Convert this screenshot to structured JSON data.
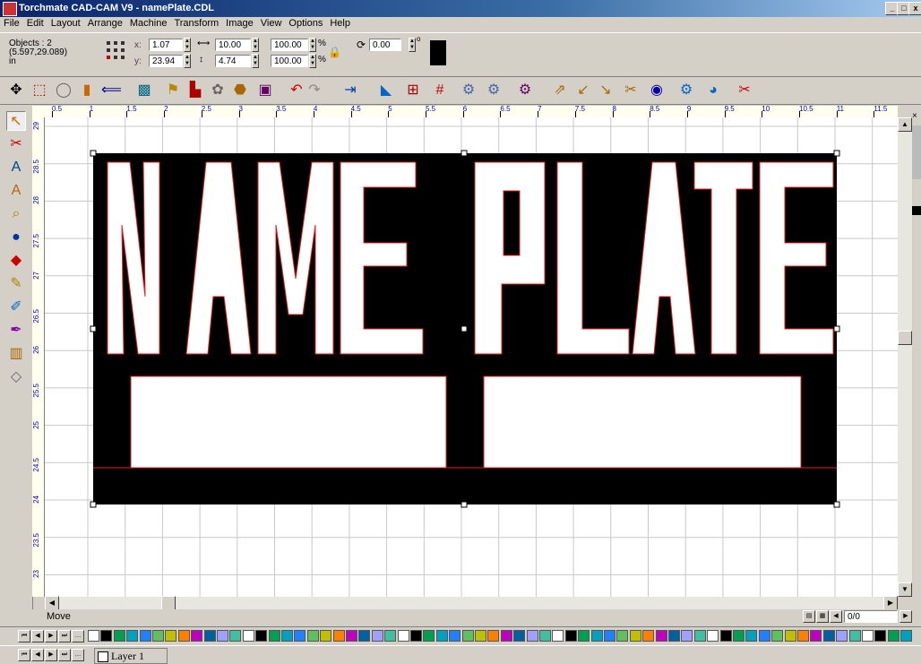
{
  "window": {
    "title": "Torchmate CAD-CAM V9 - namePlate.CDL",
    "controls": [
      "_",
      "□",
      "x"
    ]
  },
  "menu": [
    "File",
    "Edit",
    "Layout",
    "Arrange",
    "Machine",
    "Transform",
    "Image",
    "View",
    "Options",
    "Help"
  ],
  "properties": {
    "objects_label": "Objects : 2",
    "coords": "(5.597,29.089)",
    "units": "in",
    "x_label": "x:",
    "x_value": "1.07",
    "y_label": "y:",
    "y_value": "23.94",
    "width_value": "10.00",
    "height_value": "4.74",
    "scale_x": "100.00",
    "scale_y": "100.00",
    "percent": "%",
    "rotation": "0.00",
    "degree": "o"
  },
  "ruler": {
    "h_ticks": [
      "0.5",
      "1",
      "1.5",
      "2",
      "2.5",
      "3",
      "3.5",
      "4",
      "4.5",
      "5",
      "5.5",
      "6",
      "6.5",
      "7",
      "7.5",
      "8",
      "8.5",
      "9",
      "9.5",
      "10",
      "10.5",
      "11",
      "11.5"
    ],
    "v_ticks": [
      "29",
      "28.5",
      "28",
      "27.5",
      "27",
      "26.5",
      "26",
      "25.5",
      "25",
      "24.5",
      "24",
      "23.5",
      "23"
    ]
  },
  "toolbar_icons": [
    "move-icon",
    "nodes-icon",
    "circle-icon",
    "fill-icon",
    "nest-icon",
    "plate-icon",
    "flag-icon",
    "kerf-icon",
    "weld-icon",
    "bucket-icon",
    "layer-icon",
    "undo-icon",
    "redo-icon",
    "exit-icon",
    "select-icon",
    "grid-snap-icon",
    "grid-icon",
    "tool1-icon",
    "tool2-icon",
    "tool3-icon",
    "path-icon",
    "leadin-icon",
    "leadout-icon",
    "cut-icon",
    "target-icon",
    "tool4-icon",
    "tool5-icon",
    "scissors-icon"
  ],
  "tools": [
    "pointer-icon",
    "knife-icon",
    "text-icon",
    "fonttext-icon",
    "zoom-icon",
    "shape-icon",
    "blend-icon",
    "pencil-icon",
    "eraser-icon",
    "brush-icon",
    "measure-icon",
    "fillbucket-icon"
  ],
  "design": {
    "text": "NAME PLATE",
    "plate_color": "#000000",
    "outline_color": "#e02020"
  },
  "status": {
    "text": "Move",
    "page": "0/0"
  },
  "layer": {
    "name": "Layer 1"
  },
  "colors": {
    "title_start": "#0a246a",
    "title_end": "#a6caf0",
    "face": "#d4d0c8"
  }
}
